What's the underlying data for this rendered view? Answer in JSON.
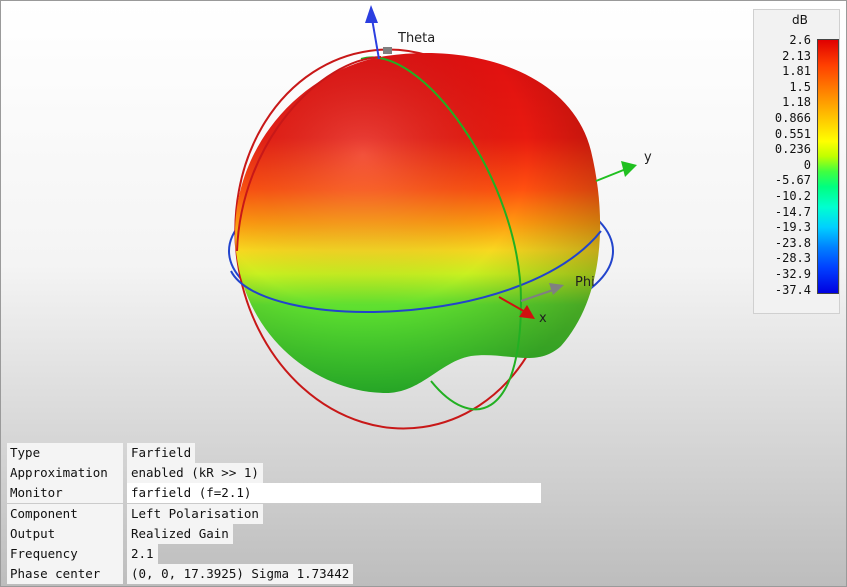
{
  "colorbar": {
    "unit": "dB",
    "ticks": [
      "2.6",
      "2.13",
      "1.81",
      "1.5",
      "1.18",
      "0.866",
      "0.551",
      "0.236",
      "0",
      "-5.67",
      "-10.2",
      "-14.7",
      "-19.3",
      "-23.8",
      "-28.3",
      "-32.9",
      "-37.4"
    ]
  },
  "axes": {
    "theta": "Theta",
    "phi": "Phi",
    "x": "x",
    "y": "y"
  },
  "info": [
    {
      "key": "Type",
      "value": "Farfield"
    },
    {
      "key": "Approximation",
      "value": "enabled (kR >> 1)"
    },
    {
      "key": "Monitor",
      "value": "farfield (f=2.1)"
    },
    {
      "key": "Component",
      "value": "Left Polarisation"
    },
    {
      "key": "Output",
      "value": "Realized Gain"
    },
    {
      "key": "Frequency",
      "value": "2.1"
    },
    {
      "key": "Phase center",
      "value": "(0, 0, 17.3925) Sigma 1.73442"
    }
  ],
  "colors": {
    "theta_axis": "#2b3ee0",
    "y_axis": "#20c020",
    "x_axis": "#d01010",
    "phi_ring": "#2244cc",
    "theta_ring_red": "#c81818",
    "theta_ring_green": "#22b022"
  }
}
